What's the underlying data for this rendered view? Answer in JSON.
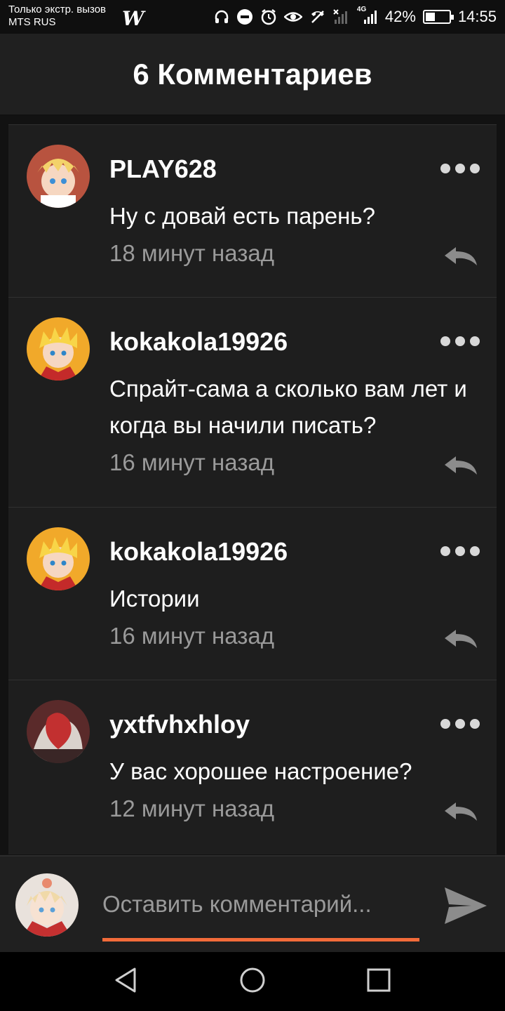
{
  "status_bar": {
    "carrier_line1": "Только экстр. вызов",
    "carrier_line2": "MTS RUS",
    "app_logo": "W",
    "network": "4G",
    "battery_percent": "42%",
    "battery_level": 0.42,
    "time": "14:55",
    "icons": [
      "headphones-icon",
      "dnd-icon",
      "alarm-icon",
      "eye-icon",
      "no-call-icon",
      "signal-x-icon",
      "signal-icon"
    ]
  },
  "header": {
    "title": "6 Комментариев"
  },
  "comments": [
    {
      "username": "PLAY628",
      "text": "Ну с довай есть парень?",
      "time": "18 минут назад"
    },
    {
      "username": "kokakola19926",
      "text": "Спрайт-сама а сколько вам лет и когда вы начили писать?",
      "time": "16 минут назад"
    },
    {
      "username": "kokakola19926",
      "text": "Истории",
      "time": "16 минут назад"
    },
    {
      "username": "yxtfvhxhloy",
      "text": "У вас хорошее настроение?",
      "time": "12 минут назад"
    }
  ],
  "composer": {
    "placeholder": "Оставить комментарий..."
  },
  "colors": {
    "accent": "#f26b3a",
    "background": "#1e1e1e",
    "muted_text": "#9a9a9a"
  }
}
